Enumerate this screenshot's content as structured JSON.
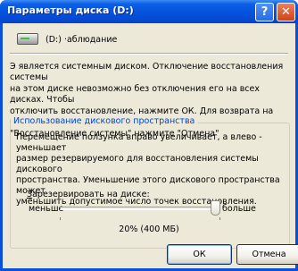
{
  "window": {
    "title": "Параметры диска (D:)",
    "help_label": "?",
    "close_label": "✕"
  },
  "drive": {
    "name": "(D:)  ·аблюдание"
  },
  "info": {
    "line1": "Э является системным диском. Отключение восстановления системы",
    "line2": "на этом диске невозможно без отключения его на всех дисках. Чтобы",
    "line3": "отключить восстановление, нажмите ОК. Для возврата на вкладку",
    "line4": "\"Восстановление системы\" нажмите \"Отмена\""
  },
  "disk_space": {
    "group_title": "Использование дискового пространства",
    "desc1": "Перемещение ползунка вправо увеличивает, а влево - уменьшает",
    "desc2": "размер резервируемого для восстановления системы дискового",
    "desc3": "пространства. Уменьшение этого дискового пространства может",
    "desc4": "уменьшить допустимое число точек восстановления.",
    "reserve_prefix": "З",
    "reserve_rest": "арезервировать на диске:",
    "less_label": "меньше",
    "more_label": "больше",
    "percent_text": "20% (400 МБ)",
    "slider_value": 1.0
  },
  "buttons": {
    "ok": "ОК",
    "cancel": "Отмена"
  }
}
